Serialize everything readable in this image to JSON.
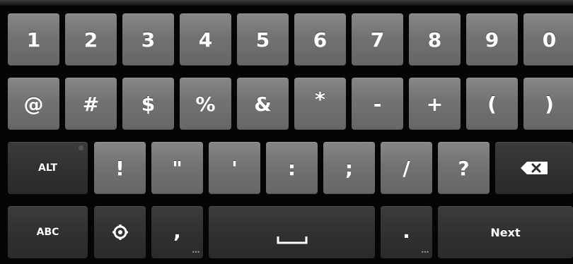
{
  "keyboard": {
    "row1": [
      "1",
      "2",
      "3",
      "4",
      "5",
      "6",
      "7",
      "8",
      "9",
      "0"
    ],
    "row2": [
      "@",
      "#",
      "$",
      "%",
      "&",
      "*",
      "-",
      "+",
      "(",
      ")"
    ],
    "row3": {
      "alt": "ALT",
      "symbols": [
        "!",
        "\"",
        "'",
        ":",
        ";",
        "/",
        "?"
      ],
      "delete_icon": "backspace-icon"
    },
    "row4": {
      "abc": "ABC",
      "settings_icon": "settings-icon",
      "comma": ",",
      "space_icon": "space-icon",
      "period": ".",
      "next": "Next"
    }
  }
}
